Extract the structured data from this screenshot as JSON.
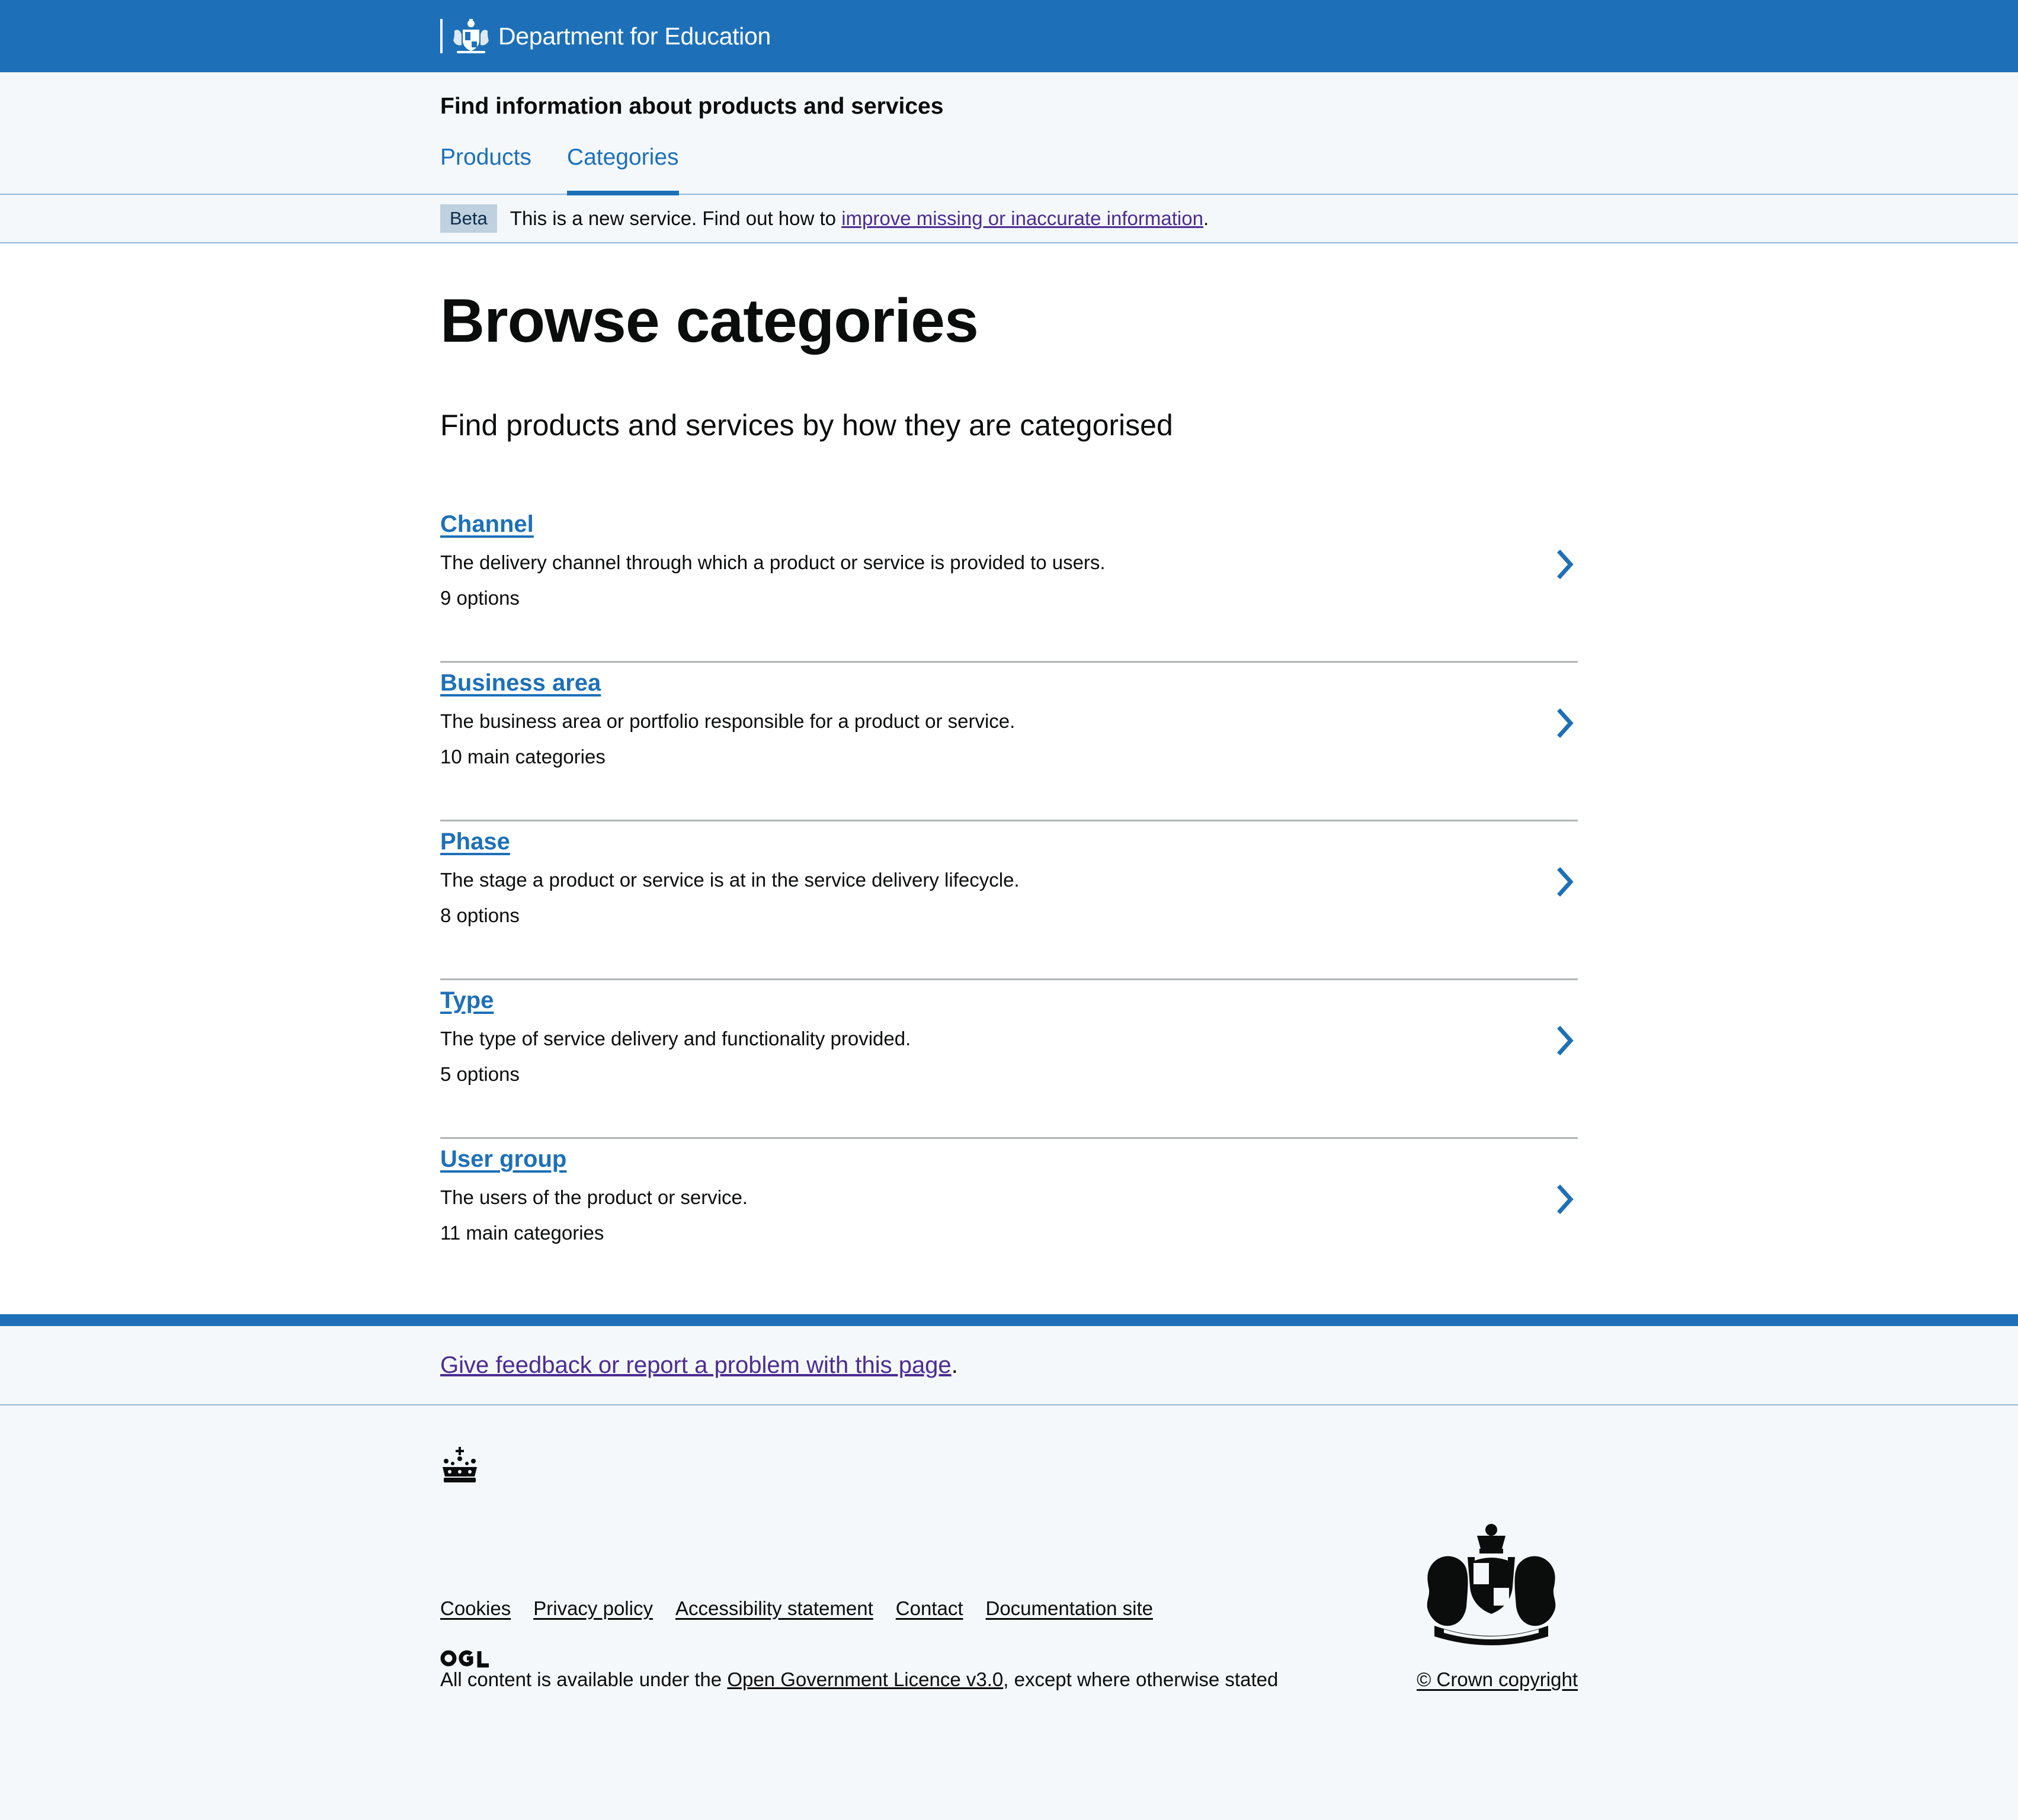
{
  "header": {
    "brand": "Department for Education",
    "service_name": "Find information about products and services",
    "nav": [
      {
        "label": "Products",
        "current": false
      },
      {
        "label": "Categories",
        "current": true
      }
    ]
  },
  "phase_banner": {
    "tag": "Beta",
    "text_before": "This is a new service. Find out how to ",
    "link_text": "improve missing or inaccurate information",
    "text_after": "."
  },
  "main": {
    "title": "Browse categories",
    "lead": "Find products and services by how they are categorised",
    "categories": [
      {
        "name": "Channel",
        "description": "The delivery channel through which a product or service is provided to users.",
        "count": "9 options"
      },
      {
        "name": "Business area",
        "description": "The business area or portfolio responsible for a product or service.",
        "count": "10 main categories"
      },
      {
        "name": "Phase",
        "description": "The stage a product or service is at in the service delivery lifecycle.",
        "count": "8 options"
      },
      {
        "name": "Type",
        "description": "The type of service delivery and functionality provided.",
        "count": "5 options"
      },
      {
        "name": "User group",
        "description": "The users of the product or service.",
        "count": "11 main categories"
      }
    ]
  },
  "footer": {
    "feedback_link": "Give feedback or report a problem with this page",
    "feedback_after": ".",
    "links": [
      "Cookies",
      "Privacy policy",
      "Accessibility statement",
      "Contact",
      "Documentation site"
    ],
    "licence_before": "All content is available under the ",
    "licence_link": "Open Government Licence v3.0",
    "licence_after": ", except where otherwise stated",
    "copyright": "© Crown copyright"
  },
  "colors": {
    "brand_blue": "#1d70b8",
    "visited_link": "#4c2c92",
    "page_bg": "#f4f8fb"
  },
  "icons": [
    "royal-crest-icon",
    "chevron-right-icon",
    "crown-icon",
    "ogl-logo",
    "royal-coat-of-arms"
  ]
}
